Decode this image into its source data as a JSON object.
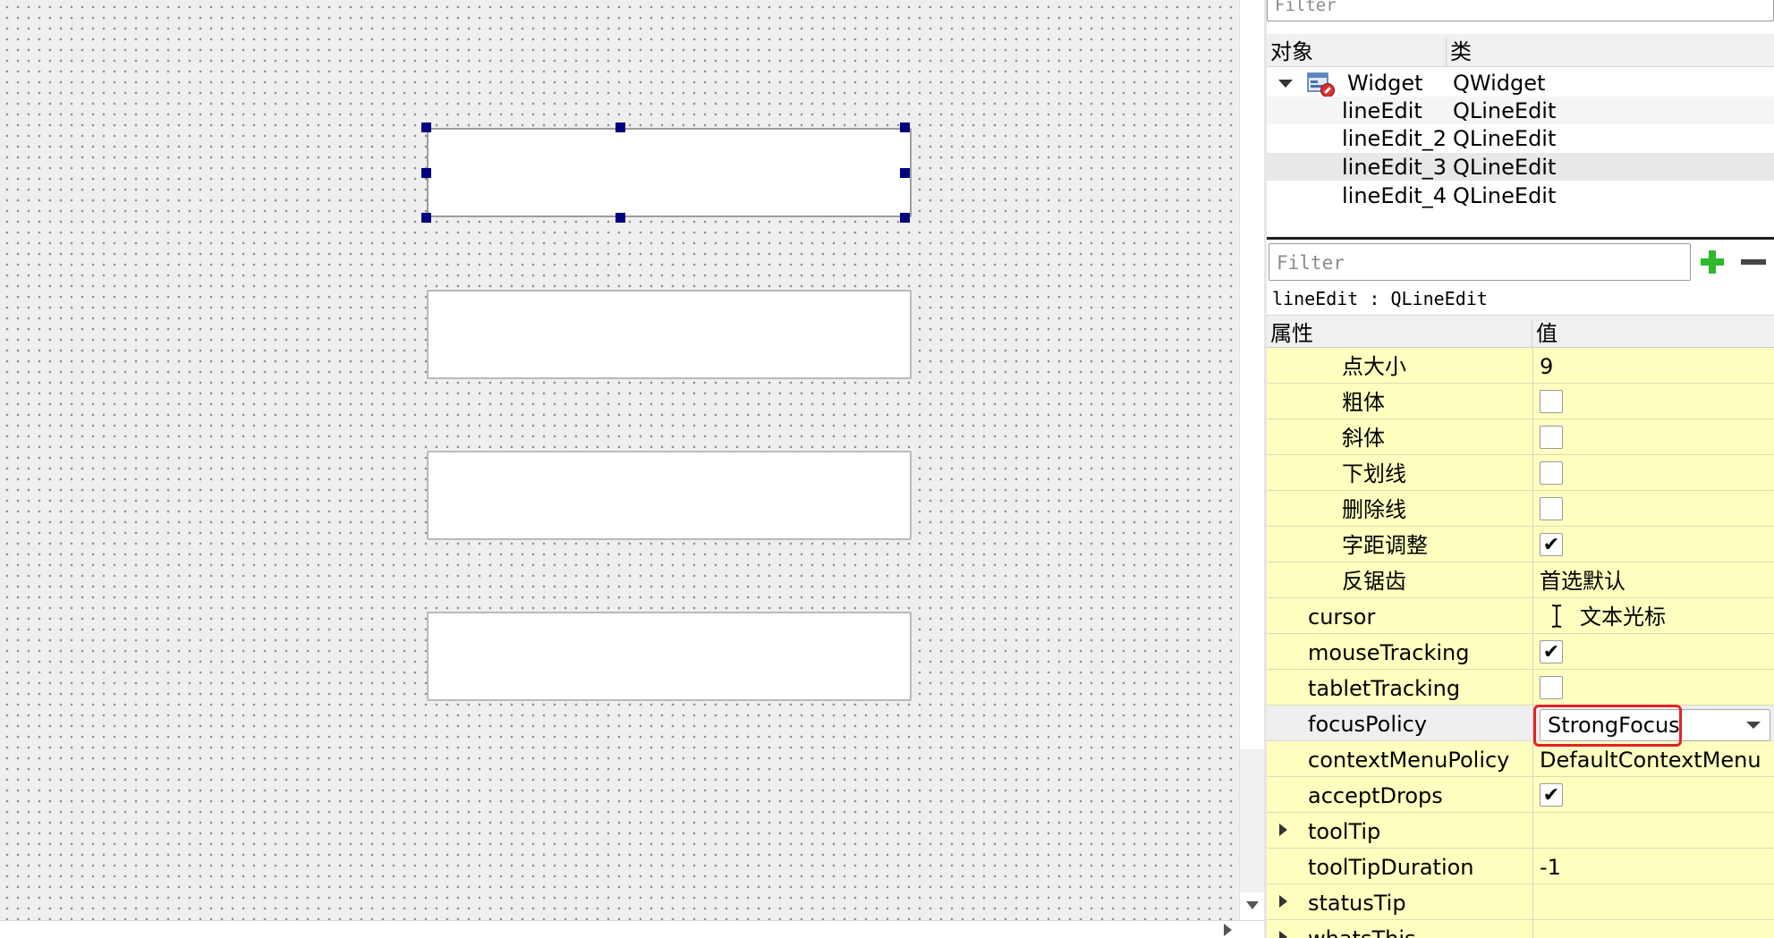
{
  "object_inspector": {
    "filter_placeholder": "Filter",
    "col_object": "对象",
    "col_class": "类",
    "objects": [
      {
        "name": "Widget",
        "class": "QWidget"
      },
      {
        "name": "lineEdit",
        "class": "QLineEdit"
      },
      {
        "name": "lineEdit_2",
        "class": "QLineEdit"
      },
      {
        "name": "lineEdit_3",
        "class": "QLineEdit"
      },
      {
        "name": "lineEdit_4",
        "class": "QLineEdit"
      }
    ]
  },
  "property_editor": {
    "filter_placeholder": "Filter",
    "current_object": "lineEdit : QLineEdit",
    "col_property": "属性",
    "col_value": "值",
    "rows": [
      {
        "key": "点大小",
        "value": "9"
      },
      {
        "key": "粗体",
        "checked": false
      },
      {
        "key": "斜体",
        "checked": false
      },
      {
        "key": "下划线",
        "checked": false
      },
      {
        "key": "删除线",
        "checked": false
      },
      {
        "key": "字距调整",
        "checked": true
      },
      {
        "key": "反锯齿",
        "value": "首选默认"
      },
      {
        "key": "cursor",
        "value": "文本光标"
      },
      {
        "key": "mouseTracking",
        "checked": true
      },
      {
        "key": "tabletTracking",
        "checked": false
      },
      {
        "key": "focusPolicy",
        "value": "StrongFocus"
      },
      {
        "key": "contextMenuPolicy",
        "value": "DefaultContextMenu"
      },
      {
        "key": "acceptDrops",
        "checked": true
      },
      {
        "key": "toolTip",
        "value": ""
      },
      {
        "key": "toolTipDuration",
        "value": "-1"
      },
      {
        "key": "statusTip",
        "value": ""
      },
      {
        "key": "whatsThis",
        "value": ""
      }
    ]
  },
  "colors": {
    "canvas_bg": "#efefef",
    "selection_handle": "#000080",
    "property_row_bg": "#ffffbf",
    "highlight": "#e0232b",
    "add_icon": "#2db82d"
  },
  "icons": {
    "widget": "widget-icon",
    "add": "plus-icon",
    "remove": "minus-icon",
    "cursor": "ibeam-cursor-icon"
  },
  "check_glyph": "✔"
}
